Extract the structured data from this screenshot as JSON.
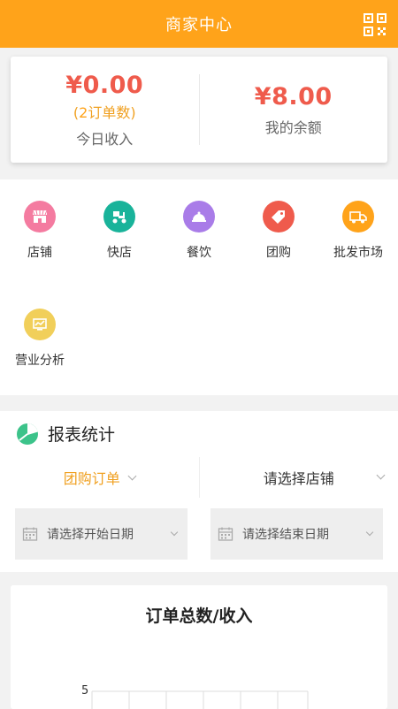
{
  "header": {
    "title": "商家中心"
  },
  "summary": {
    "today_income": "¥0.00",
    "order_count_open": "(",
    "order_count_num": "2",
    "order_count_rest": "订单数)",
    "today_caption": "今日收入",
    "balance": "¥8.00",
    "balance_caption": "我的余额"
  },
  "menu": {
    "items": [
      {
        "label": "店铺",
        "icon": "store-icon",
        "color": "#f47ba0"
      },
      {
        "label": "快店",
        "icon": "delivery-scooter-icon",
        "color": "#19b39a"
      },
      {
        "label": "餐饮",
        "icon": "food-cloche-icon",
        "color": "#a97ce8"
      },
      {
        "label": "团购",
        "icon": "tag-icon",
        "color": "#ef5b4c"
      },
      {
        "label": "批发市场",
        "icon": "truck-icon",
        "color": "#ffa31a"
      },
      {
        "label": "营业分析",
        "icon": "chart-monitor-icon",
        "color": "#f1cf5a"
      }
    ]
  },
  "report": {
    "title": "报表统计",
    "order_type": "团购订单",
    "store_placeholder": "请选择店铺",
    "start_date": "请选择开始日期",
    "end_date": "请选择结束日期"
  },
  "chart": {
    "title": "订单总数/收入",
    "y_tick_top": "5"
  },
  "colors": {
    "accent": "#ffa31a",
    "amount_red": "#ef5b4c",
    "report_icon_green": "#3cc38a"
  }
}
